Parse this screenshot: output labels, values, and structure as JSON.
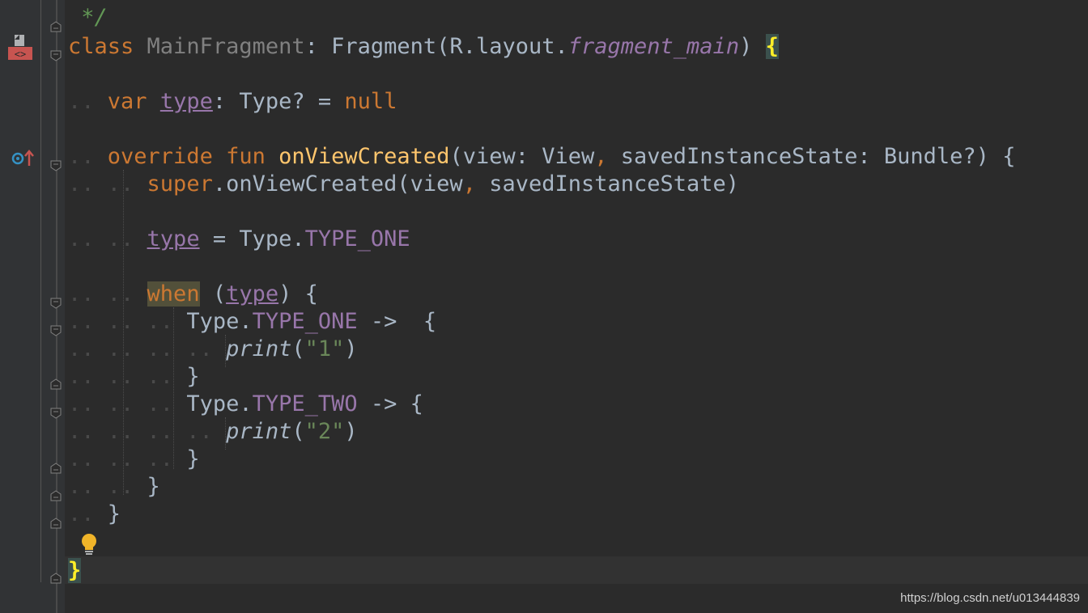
{
  "editor": {
    "language": "Kotlin",
    "comment_close": " */",
    "lines": {
      "class_kw": "class",
      "class_name": "MainFragment",
      "class_colon": ":",
      "class_super": " Fragment(R.layout.",
      "class_res": "fragment_main",
      "class_close": ") ",
      "class_brace": "{",
      "var_kw": "var",
      "var_name": "type",
      "var_type": ": Type? = ",
      "var_null": "null",
      "override_kw": "override fun",
      "fun_name": "onViewCreated",
      "fun_params_1": "(view: View",
      "fun_comma": ",",
      "fun_params_2": " savedInstanceState: Bundle?) {",
      "super_kw": "super",
      "super_call": ".onViewCreated(view",
      "super_comma": ",",
      "super_args": " savedInstanceState)",
      "assign_field": "type",
      "assign_eq": " = Type.",
      "assign_const": "TYPE_ONE",
      "when_kw": "when",
      "when_open": " (",
      "when_field": "type",
      "when_close": ") {",
      "case1_type": "Type.",
      "case1_const": "TYPE_ONE",
      "case1_arrow": " ->  {",
      "print_fn": "print",
      "print1_open": "(",
      "print1_str": "\"1\"",
      "print1_close": ")",
      "close_brace": "}",
      "case2_type": "Type.",
      "case2_const": "TYPE_TWO",
      "case2_arrow": " -> {",
      "print2_str": "\"2\"",
      "class_end_brace": "}"
    }
  },
  "watermark": "https://blog.csdn.net/u013444839",
  "colors": {
    "background": "#2b2b2b",
    "gutter": "#313335",
    "keyword": "#cc7832",
    "function": "#ffc66d",
    "constant": "#9876aa",
    "string": "#6a8759",
    "default": "#a9b7c6",
    "brace_highlight": "#ffef28"
  },
  "icons": [
    "class-file-icon",
    "override-method-icon",
    "fold-marker-icon",
    "intention-bulb-icon"
  ]
}
